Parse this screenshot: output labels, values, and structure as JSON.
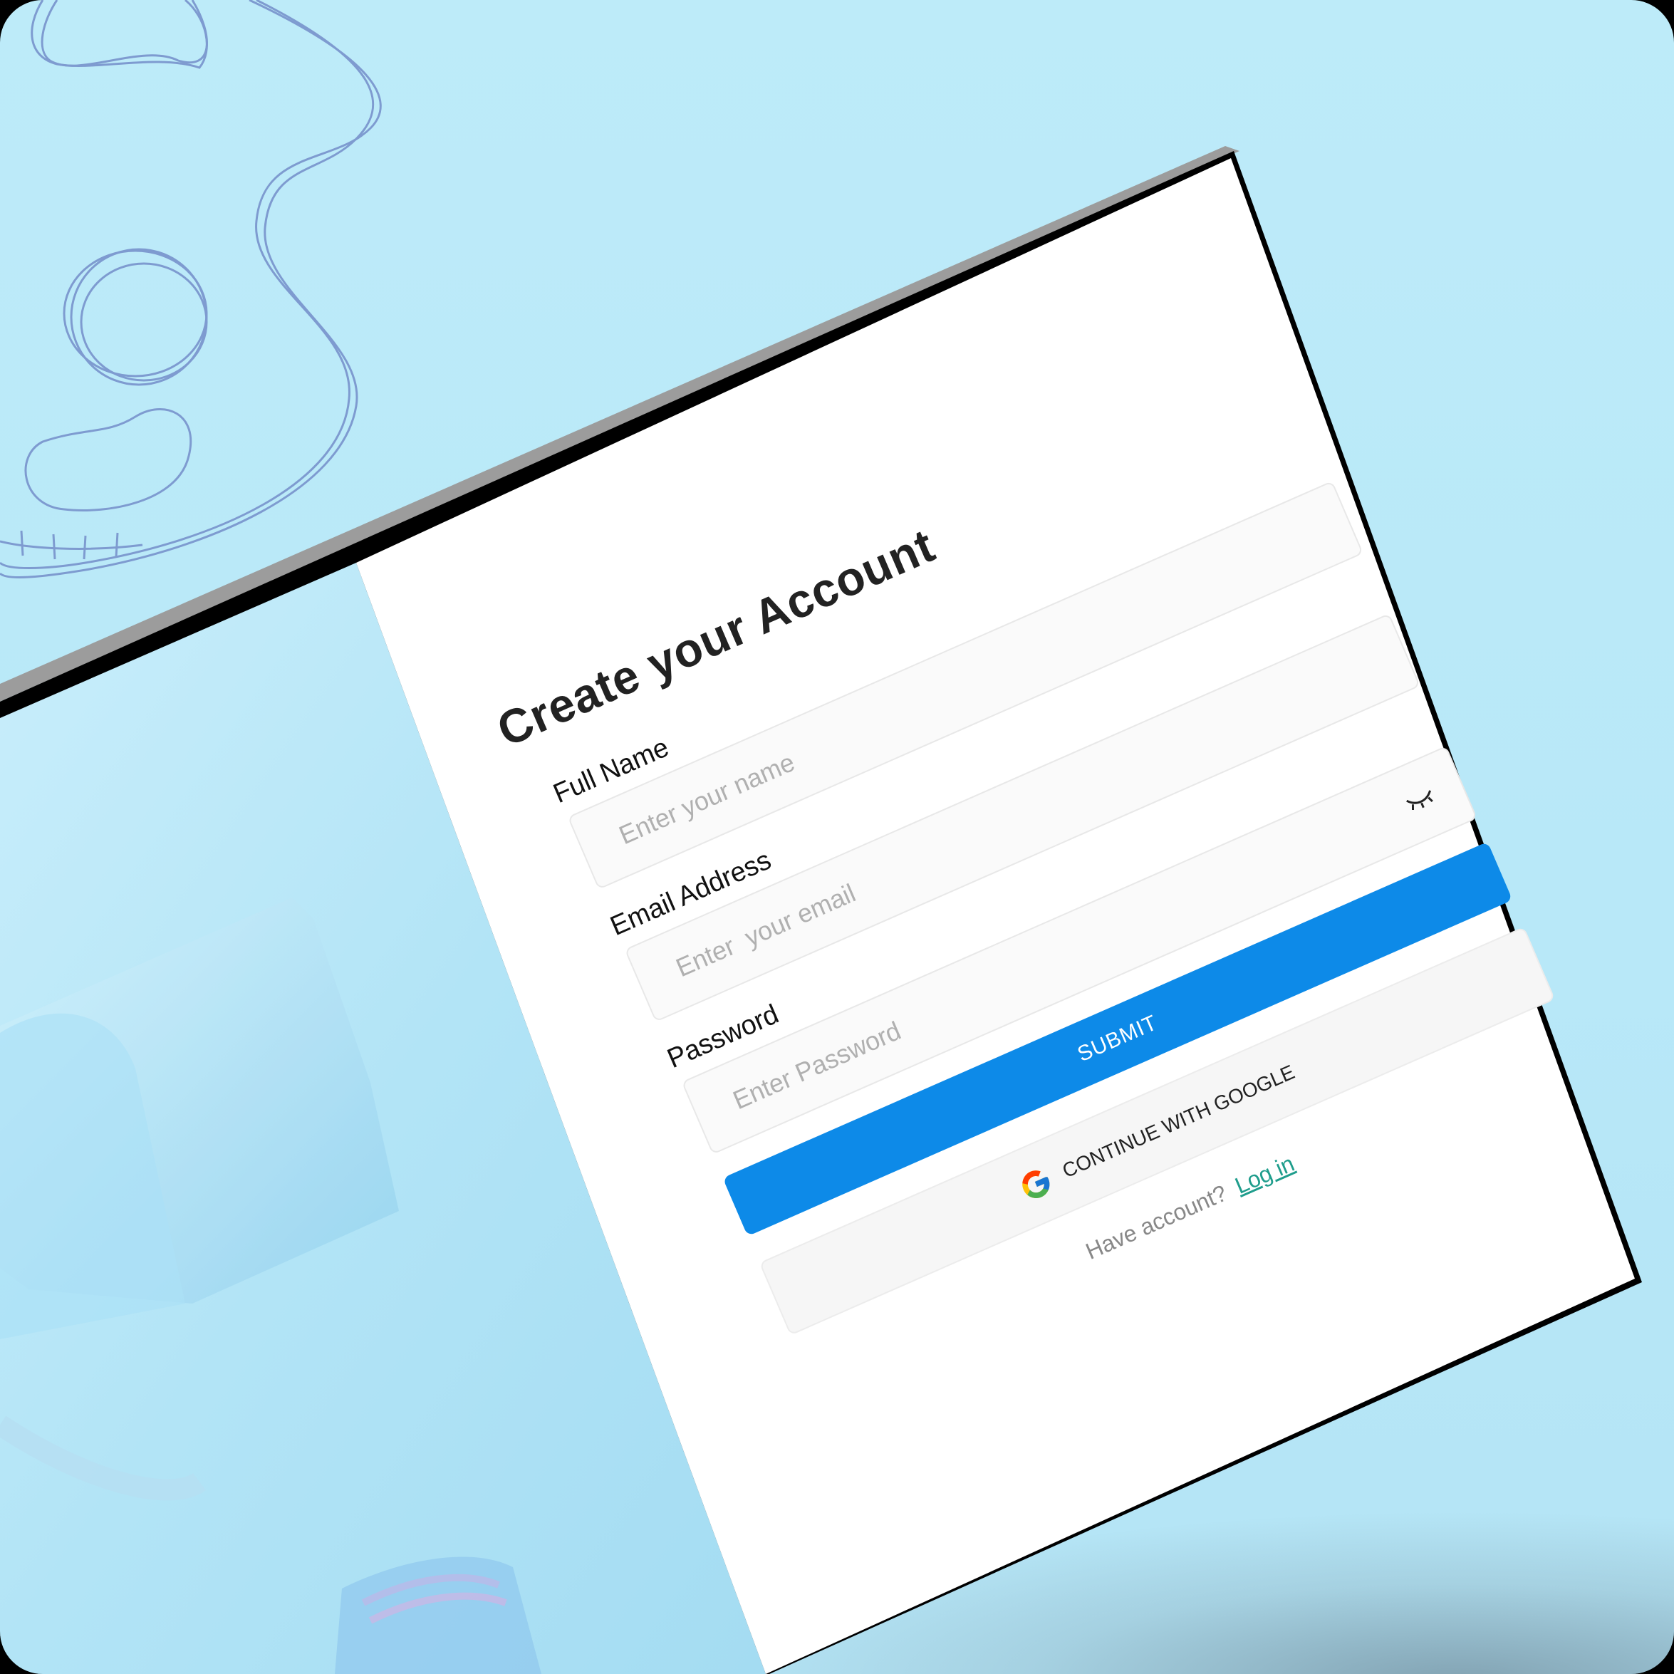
{
  "form": {
    "title": "Create your Account",
    "fields": [
      {
        "label": "Full Name",
        "placeholder": "Enter your name"
      },
      {
        "label": "Email Address",
        "placeholder": "Enter  your email"
      },
      {
        "label": "Password",
        "placeholder": "Enter Password"
      }
    ],
    "submit_label": "SUBMIT",
    "google_label": "CONTINUE WITH GOOGLE",
    "login_prompt": "Have account?",
    "login_link": "Log in"
  },
  "colors": {
    "background": "#bdebf9",
    "primary_button": "#0d8ae8",
    "link": "#1f9d8c",
    "frame": "#000000"
  },
  "icons": [
    "eye-closed-icon",
    "google-icon"
  ]
}
